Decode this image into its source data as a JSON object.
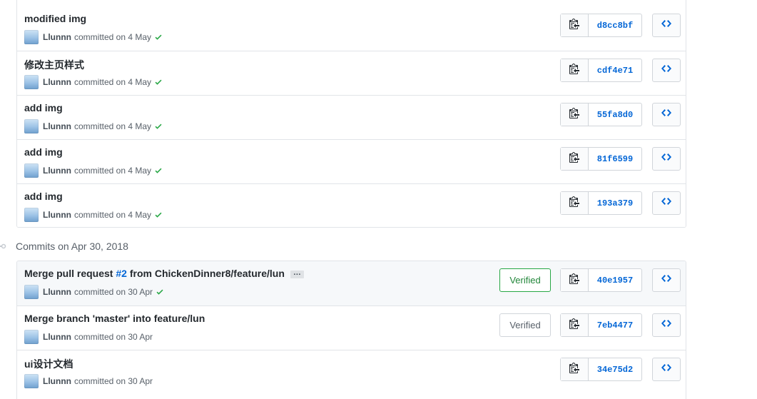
{
  "colors": {
    "link": "#0366d6",
    "verified_green": "#28a745",
    "muted": "#586069",
    "border": "#e1e4e8",
    "highlight_row": "#f6f8fa"
  },
  "top_group": {
    "commits": [
      {
        "title": "modified img",
        "author": "Llunnn",
        "meta": "committed on 4 May",
        "check": true,
        "sha": "d8cc8bf"
      },
      {
        "title": "修改主页样式",
        "author": "Llunnn",
        "meta": "committed on 4 May",
        "check": true,
        "sha": "cdf4e71"
      },
      {
        "title": "add img",
        "author": "Llunnn",
        "meta": "committed on 4 May",
        "check": true,
        "sha": "55fa8d0"
      },
      {
        "title": "add img",
        "author": "Llunnn",
        "meta": "committed on 4 May",
        "check": true,
        "sha": "81f6599"
      },
      {
        "title": "add img",
        "author": "Llunnn",
        "meta": "committed on 4 May",
        "check": true,
        "sha": "193a379"
      }
    ]
  },
  "date_header": "Commits on Apr 30, 2018",
  "bottom_group": {
    "commits": [
      {
        "title_prefix": "Merge pull request ",
        "pr_link": "#2",
        "title_suffix": " from ChickenDinner8/feature/lun",
        "ellipsis": "…",
        "author": "Llunnn",
        "meta": "committed on 30 Apr",
        "check": true,
        "verified": "Verified",
        "sha": "40e1957"
      },
      {
        "title": "Merge branch 'master' into feature/lun",
        "author": "Llunnn",
        "meta": "committed on 30 Apr",
        "verified": "Verified",
        "sha": "7eb4477"
      },
      {
        "title": "ui设计文档",
        "author": "Llunnn",
        "meta": "committed on 30 Apr",
        "sha": "34e75d2"
      }
    ]
  },
  "icons": {
    "copy": "clippy-icon",
    "browse": "code-icon",
    "check": "check-icon",
    "timeline": "git-commit-icon"
  }
}
